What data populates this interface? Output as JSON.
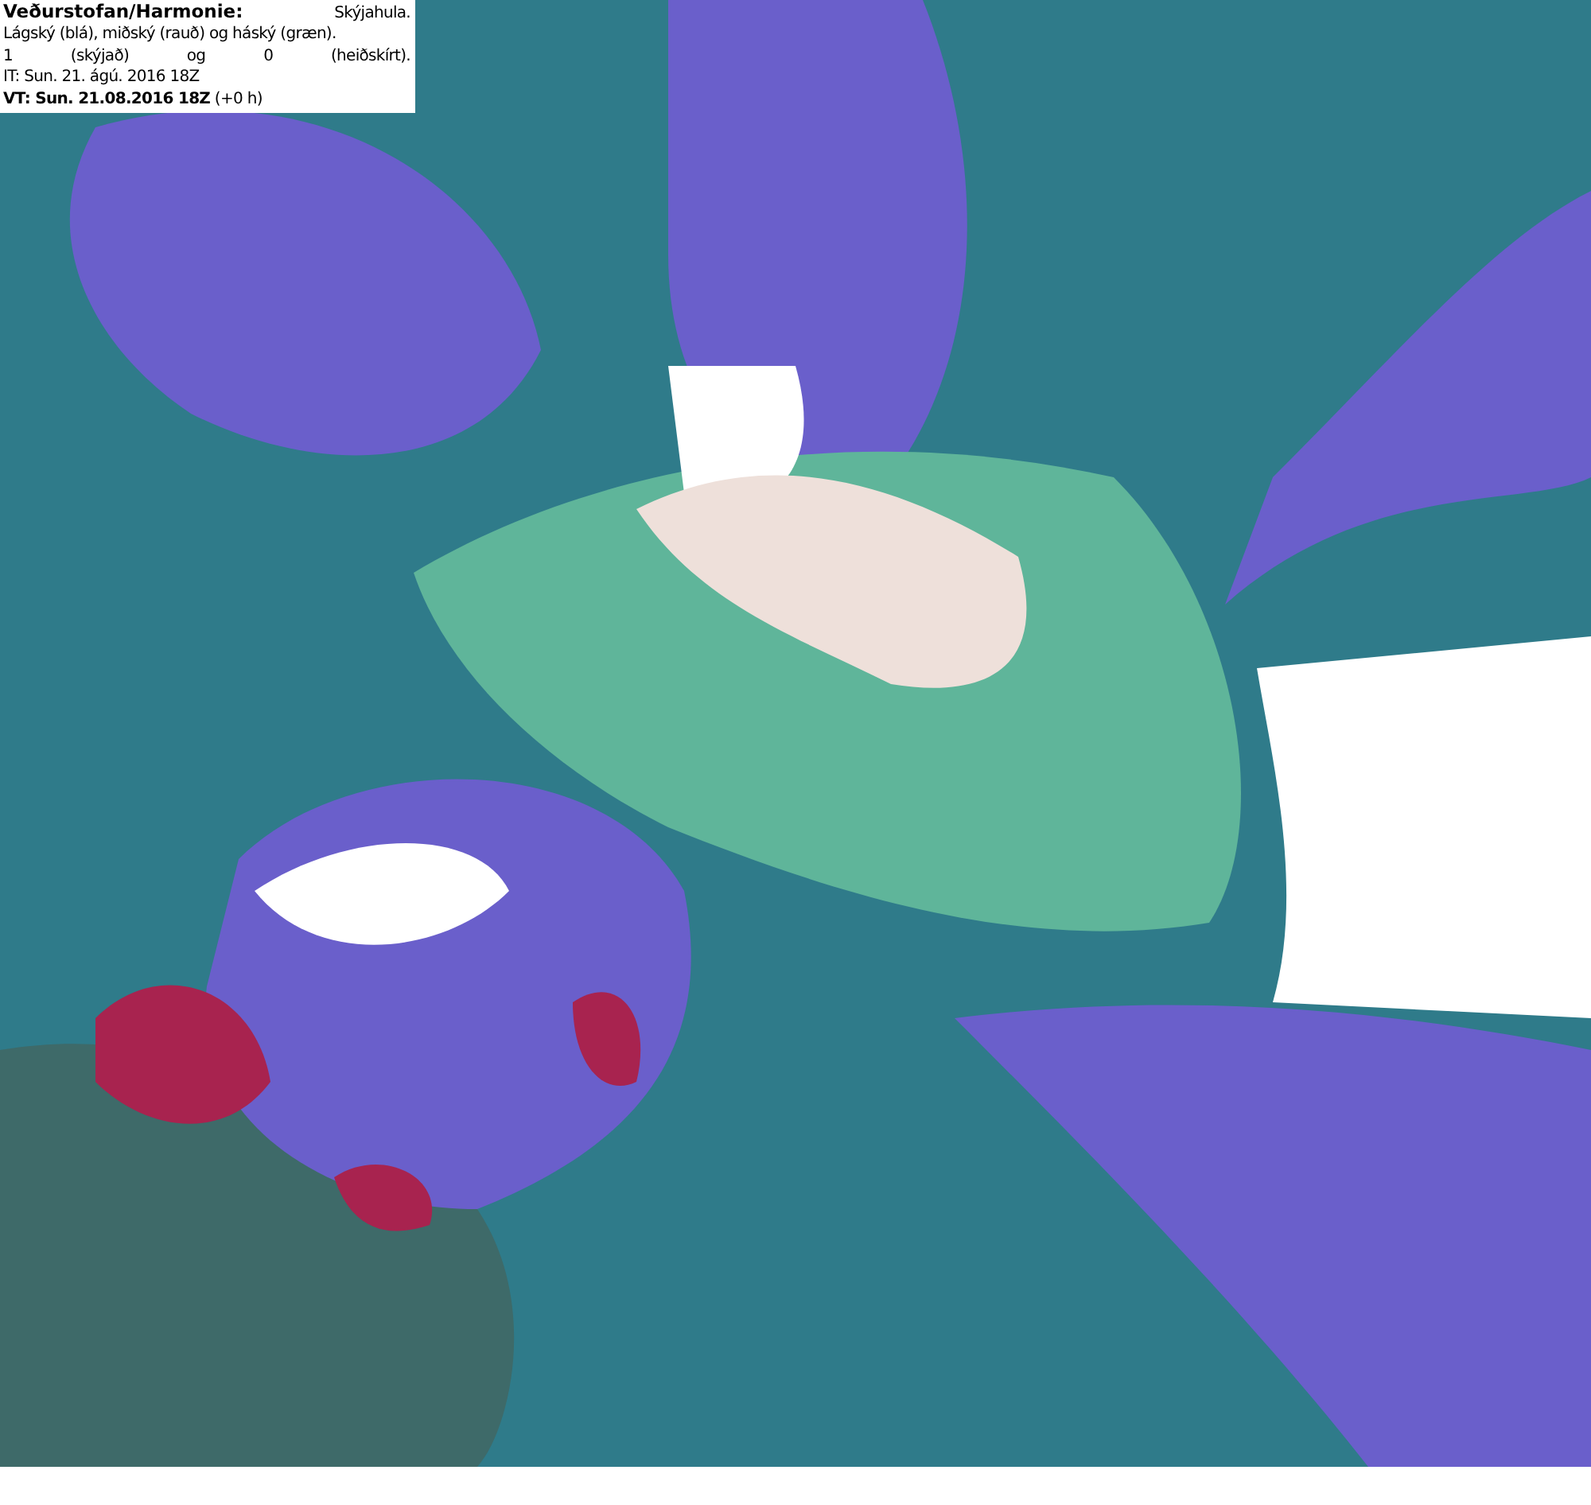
{
  "legend": {
    "title": "Veðurstofan/Harmonie:",
    "subtitle": "Skýjahula.",
    "lines": [
      "Lágský (blá), miðský (rauð) og háský (græn).",
      "1 (skýjað) og 0 (heiðskírt)."
    ],
    "issued": "IT: Sun. 21. ágú. 2016 18Z",
    "valid": "**VT: Sun. 21.08.2016 18Z** (+0 h)"
  }
}
